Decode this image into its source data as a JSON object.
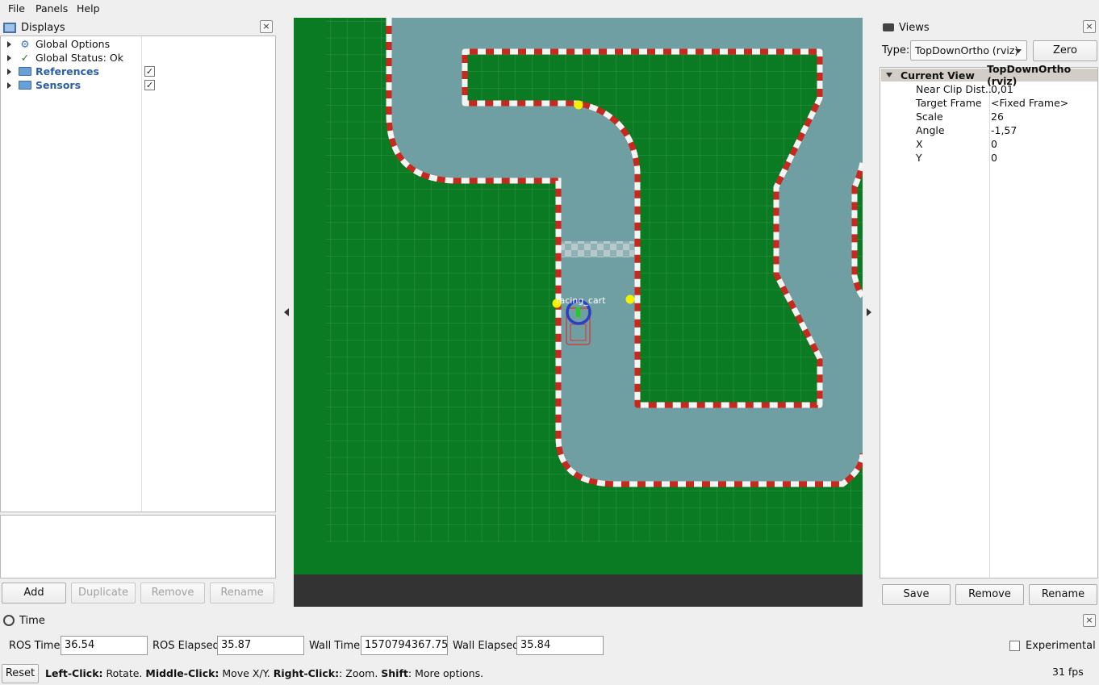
{
  "menu": {
    "file": "File",
    "panels": "Panels",
    "help": "Help"
  },
  "displays": {
    "title": "Displays",
    "items": [
      {
        "label": "Global Options",
        "icon": "gear-icon",
        "bold": false,
        "color": "#111111"
      },
      {
        "label": "Global Status: Ok",
        "icon": "check-icon",
        "bold": false,
        "color": "#111111"
      },
      {
        "label": "References",
        "icon": "folder-icon",
        "bold": true,
        "color": "#2a5fa8",
        "checked": "✓"
      },
      {
        "label": "Sensors",
        "icon": "folder-icon",
        "bold": true,
        "color": "#2a5fa8",
        "checked": "✓"
      }
    ],
    "buttons": {
      "add": "Add",
      "duplicate": "Duplicate",
      "remove": "Remove",
      "rename": "Rename"
    }
  },
  "viewport": {
    "label": "racing_cart",
    "colors": {
      "grass": "#0a7a23",
      "track": "#6f9ea3",
      "curb_red": "#c8281e",
      "curb_white": "#f4f4f4",
      "bottom_bar": "#333333"
    }
  },
  "views": {
    "title": "Views",
    "type_label": "Type:",
    "type_value": "TopDownOrtho (rviz)",
    "zero": "Zero",
    "header": {
      "name": "Current View",
      "value": "TopDownOrtho (rviz)"
    },
    "props": [
      {
        "name": "Near Clip Dist...",
        "value": "0,01"
      },
      {
        "name": "Target Frame",
        "value": "<Fixed Frame>"
      },
      {
        "name": "Scale",
        "value": "26"
      },
      {
        "name": "Angle",
        "value": "-1,57"
      },
      {
        "name": "X",
        "value": "0"
      },
      {
        "name": "Y",
        "value": "0"
      }
    ],
    "buttons": {
      "save": "Save",
      "remove": "Remove",
      "rename": "Rename"
    }
  },
  "time": {
    "title": "Time",
    "ros_time_label": "ROS Time:",
    "ros_time": "36.54",
    "ros_elapsed_label": "ROS Elapsed:",
    "ros_elapsed": "35.87",
    "wall_time_label": "Wall Time:",
    "wall_time": "1570794367.75",
    "wall_elapsed_label": "Wall Elapsed:",
    "wall_elapsed": "35.84",
    "experimental": "Experimental"
  },
  "status": {
    "reset": "Reset",
    "hint_left_key": "Left-Click:",
    "hint_left": " Rotate. ",
    "hint_mid_key": "Middle-Click:",
    "hint_mid": " Move X/Y. ",
    "hint_right_key": "Right-Click:",
    "hint_right": ": Zoom. ",
    "hint_shift_key": "Shift",
    "hint_shift": ": More options.",
    "fps": "31 fps"
  }
}
